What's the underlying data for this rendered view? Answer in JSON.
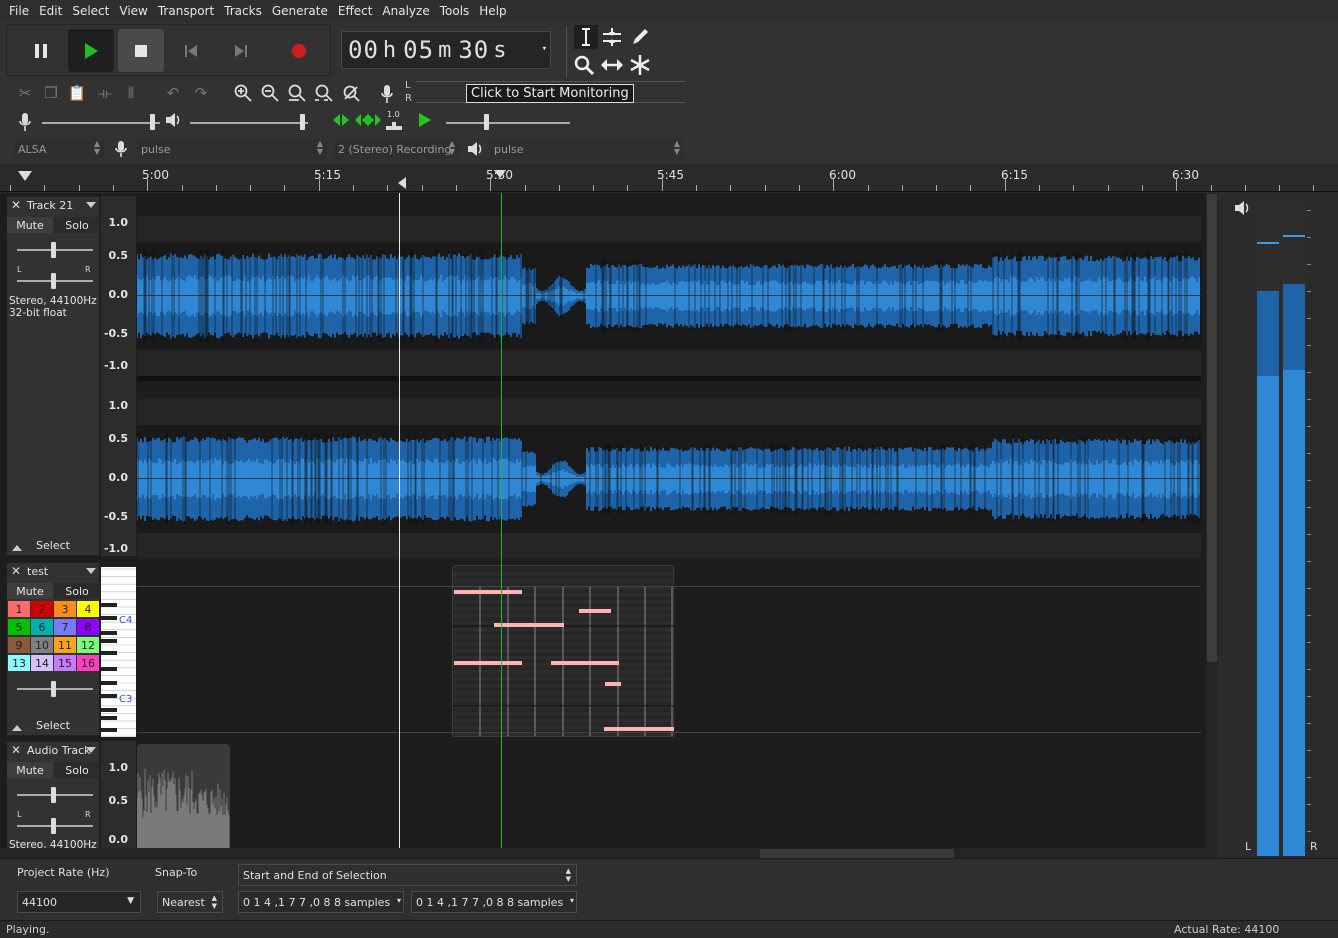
{
  "menu": [
    "File",
    "Edit",
    "Select",
    "View",
    "Transport",
    "Tracks",
    "Generate",
    "Effect",
    "Analyze",
    "Tools",
    "Help"
  ],
  "time": {
    "hh": "00",
    "h_unit": "h",
    "mm": "05",
    "m_unit": "m",
    "ss": "30",
    "s_unit": "s"
  },
  "meter_toolbar": {
    "rec_l": "L",
    "rec_r": "R",
    "tooltip": "Click to Start Monitoring"
  },
  "mixer": {
    "play_speed_label": "1.0"
  },
  "devices": {
    "host": "ALSA",
    "recording_device": "pulse",
    "channels": "2 (Stereo) Recording",
    "playback_device": "pulse"
  },
  "ruler": {
    "ticks": [
      "5:00",
      "5:15",
      "5:30",
      "5:45",
      "6:00",
      "6:15",
      "6:30"
    ]
  },
  "tracks": [
    {
      "name": "Track 21",
      "mute": "Mute",
      "solo": "Solo",
      "pan_l": "L",
      "pan_r": "R",
      "info_line1": "Stereo, 44100Hz",
      "info_line2": "32-bit float",
      "select": "Select",
      "scale": [
        "1.0",
        "0.5",
        "0.0",
        "-0.5",
        "-1.0"
      ]
    },
    {
      "name": "test",
      "mute": "Mute",
      "solo": "Solo",
      "channels": [
        "1",
        "2",
        "3",
        "4",
        "5",
        "6",
        "7",
        "8",
        "9",
        "10",
        "11",
        "12",
        "13",
        "14",
        "15",
        "16"
      ],
      "channel_colors": [
        "#ff6b6b",
        "#d40000",
        "#ff8c1a",
        "#ffff00",
        "#00c000",
        "#00b0b0",
        "#7a7aff",
        "#9000ff",
        "#8c5a3c",
        "#808080",
        "#ffa31a",
        "#7aff7a",
        "#8cffff",
        "#d7c0ff",
        "#c87aff",
        "#ff3ec0"
      ],
      "select": "Select",
      "piano_labels": [
        "C4",
        "C3"
      ]
    },
    {
      "name": "Audio Track",
      "mute": "Mute",
      "solo": "Solo",
      "pan_l": "L",
      "pan_r": "R",
      "info_line1": "Stereo, 44100Hz",
      "scale": [
        "1.0",
        "0.5",
        "0.0"
      ]
    }
  ],
  "meters": {
    "left": "L",
    "right": "R",
    "left_level": 0.73,
    "right_level": 0.74
  },
  "selection_bar": {
    "project_rate_label": "Project Rate (Hz)",
    "project_rate": "44100",
    "snap_label": "Snap-To",
    "snap_value": "Nearest",
    "selection_mode": "Start and End of Selection",
    "start": "0 1 4 ,1 7 7 ,0 8 8  samples",
    "end": "0 1 4 ,1 7 7 ,0 8 8  samples"
  },
  "status": {
    "left": "Playing.",
    "right": "Actual Rate: 44100"
  },
  "colors": {
    "wave": "#2f88d6",
    "wave_dark": "#1f63a8",
    "playhead": "#28b428",
    "midi_note": "#ffb3b3"
  }
}
